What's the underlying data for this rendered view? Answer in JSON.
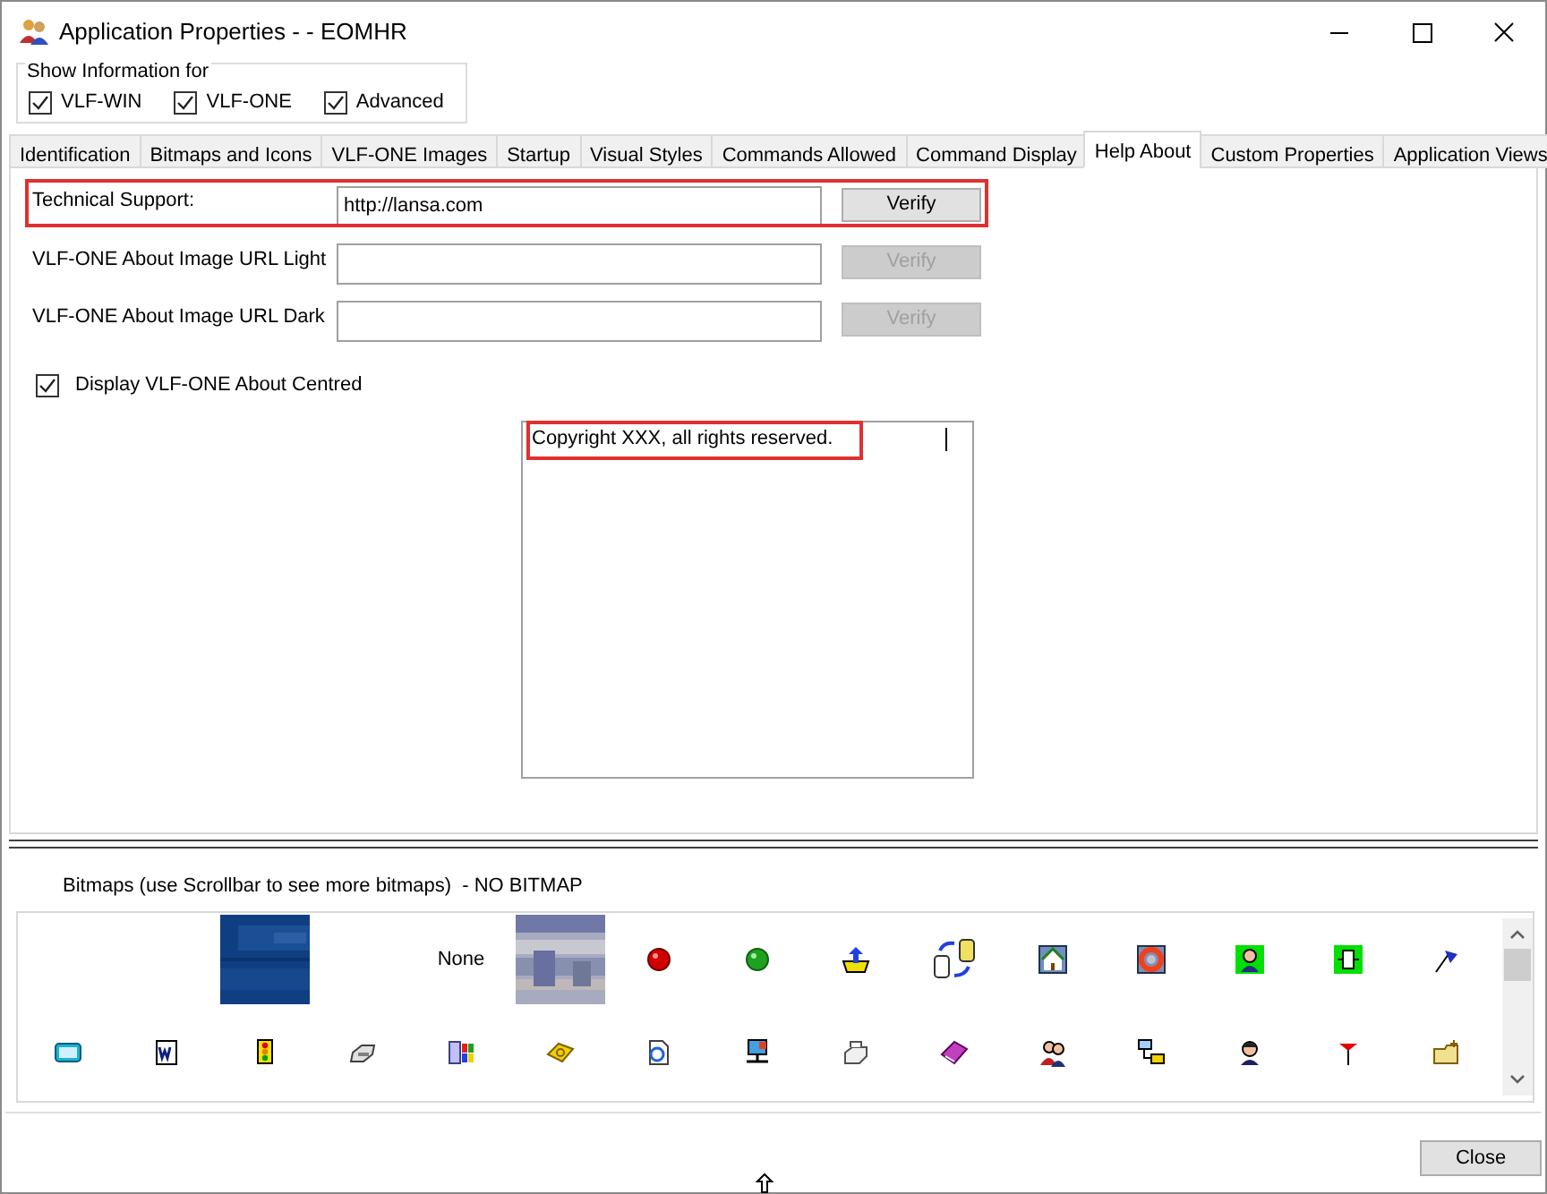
{
  "window": {
    "title": "Application Properties - - EOMHR"
  },
  "show_information": {
    "label": "Show Information for",
    "options": [
      {
        "label": "VLF-WIN",
        "checked": true
      },
      {
        "label": "VLF-ONE",
        "checked": true
      },
      {
        "label": "Advanced",
        "checked": true
      }
    ]
  },
  "tabs": [
    {
      "label": "Identification",
      "selected": false
    },
    {
      "label": "Bitmaps and Icons",
      "selected": false
    },
    {
      "label": "VLF-ONE Images",
      "selected": false
    },
    {
      "label": "Startup",
      "selected": false
    },
    {
      "label": "Visual Styles",
      "selected": false
    },
    {
      "label": "Commands Allowed",
      "selected": false
    },
    {
      "label": "Command Display",
      "selected": false
    },
    {
      "label": "Help About",
      "selected": true
    },
    {
      "label": "Custom Properties",
      "selected": false
    },
    {
      "label": "Application Views",
      "selected": false
    }
  ],
  "fields": [
    {
      "label": "Technical Support:",
      "value": "http://lansa.com",
      "button": "Verify",
      "button_disabled": false,
      "highlighted": true
    },
    {
      "label": "VLF-ONE About Image URL Light",
      "button": "Verify",
      "button_disabled": true,
      "highlighted": false
    },
    {
      "label": "VLF-ONE About Image URL Dark",
      "button": "Verify",
      "button_disabled": true,
      "highlighted": false
    }
  ],
  "display_centred": {
    "label": "Display VLF-ONE About Centred",
    "checked": true
  },
  "about_text": {
    "value": "Copyright XXX, all rights reserved.",
    "highlighted": true
  },
  "bitmaps": {
    "label": "Bitmaps (use Scrollbar to see more bitmaps)  - NO BITMAP",
    "rows": [
      [
        {
          "kind": "blank"
        },
        {
          "kind": "blank"
        },
        {
          "kind": "picture"
        },
        {
          "kind": "blank"
        },
        {
          "kind": "text",
          "text": "None"
        },
        {
          "kind": "picture"
        },
        {
          "kind": "icon"
        },
        {
          "kind": "icon"
        },
        {
          "kind": "icon"
        },
        {
          "kind": "icon"
        },
        {
          "kind": "icon"
        },
        {
          "kind": "icon"
        },
        {
          "kind": "icon"
        },
        {
          "kind": "icon"
        },
        {
          "kind": "icon"
        }
      ],
      [
        {
          "kind": "icon"
        },
        {
          "kind": "icon"
        },
        {
          "kind": "icon"
        },
        {
          "kind": "icon"
        },
        {
          "kind": "icon"
        },
        {
          "kind": "icon"
        },
        {
          "kind": "icon"
        },
        {
          "kind": "icon"
        },
        {
          "kind": "icon"
        },
        {
          "kind": "icon"
        },
        {
          "kind": "icon"
        },
        {
          "kind": "icon"
        },
        {
          "kind": "icon"
        },
        {
          "kind": "icon"
        },
        {
          "kind": "icon"
        }
      ]
    ]
  },
  "close_button": "Close"
}
